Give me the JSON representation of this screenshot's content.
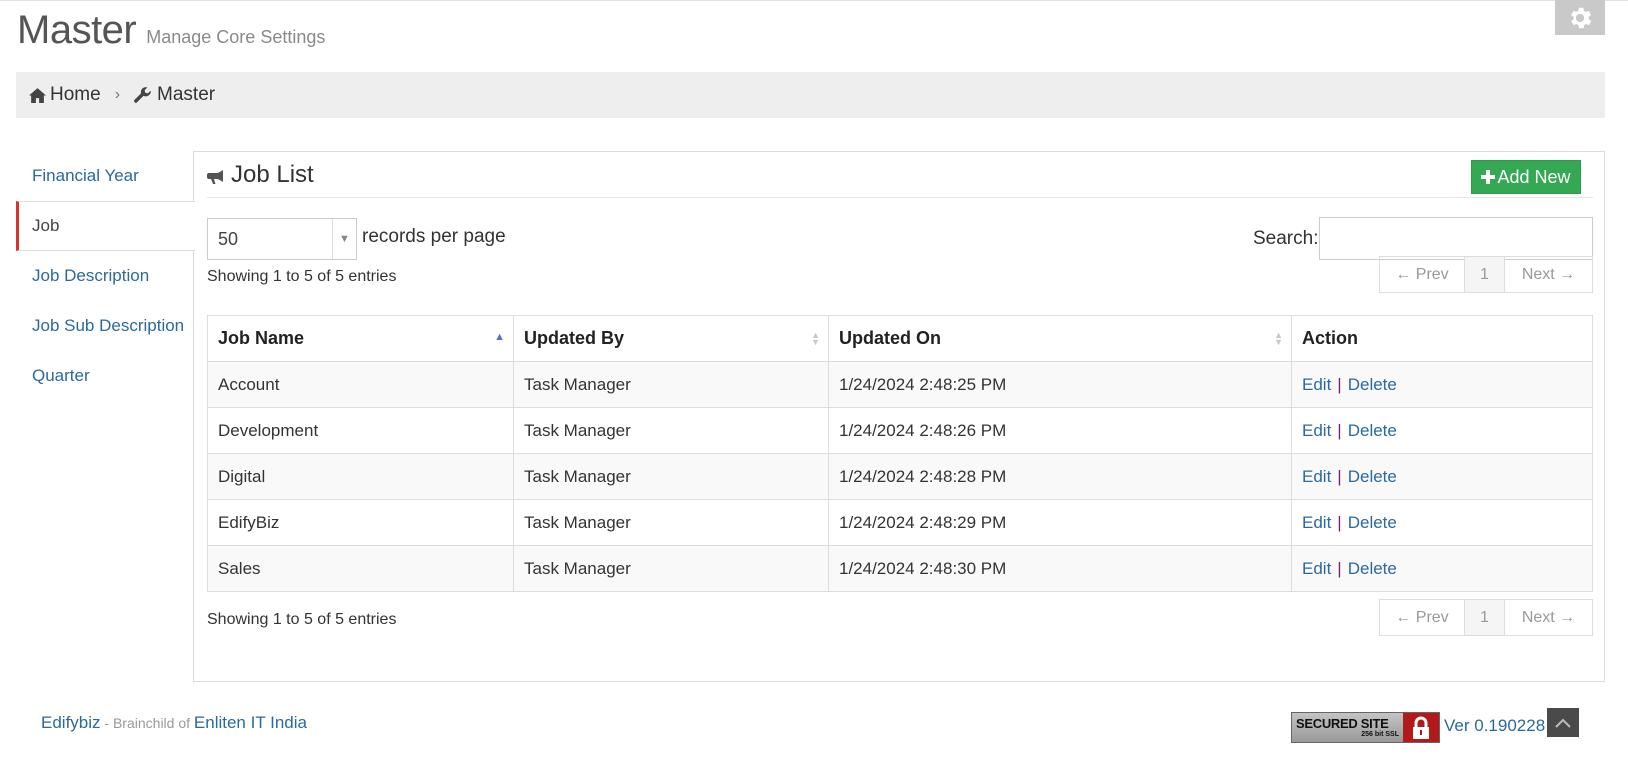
{
  "header": {
    "title": "Master",
    "subtitle": "Manage Core Settings"
  },
  "breadcrumb": {
    "home": "Home",
    "current": "Master"
  },
  "sidebar": {
    "items": [
      {
        "label": "Financial Year"
      },
      {
        "label": "Job"
      },
      {
        "label": "Job Description"
      },
      {
        "label": "Job Sub Description"
      },
      {
        "label": "Quarter"
      }
    ],
    "active_index": 1
  },
  "panel": {
    "title": "Job List",
    "add_button": "Add New"
  },
  "controls": {
    "page_length": "50",
    "page_length_label": "records per page",
    "search_label": "Search:",
    "search_value": "",
    "info_text": "Showing 1 to 5 of 5 entries"
  },
  "pagination": {
    "prev": "← Prev",
    "current": "1",
    "next": "Next →"
  },
  "table": {
    "columns": [
      "Job Name",
      "Updated By",
      "Updated On",
      "Action"
    ],
    "sorted_column": "Job Name",
    "sort_direction": "asc",
    "rows": [
      {
        "job_name": "Account",
        "updated_by": "Task Manager",
        "updated_on": "1/24/2024 2:48:25 PM"
      },
      {
        "job_name": "Development",
        "updated_by": "Task Manager",
        "updated_on": "1/24/2024 2:48:26 PM"
      },
      {
        "job_name": "Digital",
        "updated_by": "Task Manager",
        "updated_on": "1/24/2024 2:48:28 PM"
      },
      {
        "job_name": "EdifyBiz",
        "updated_by": "Task Manager",
        "updated_on": "1/24/2024 2:48:29 PM"
      },
      {
        "job_name": "Sales",
        "updated_by": "Task Manager",
        "updated_on": "1/24/2024 2:48:30 PM"
      }
    ],
    "edit_label": "Edit",
    "separator": "|",
    "delete_label": "Delete"
  },
  "footer": {
    "brand": "Edifybiz",
    "tagline": " - Brainchild of ",
    "company": "Enliten IT India",
    "ssl_title": "SECURED SITE",
    "ssl_sub": "256 bit SSL",
    "version": "Ver 0.190228"
  },
  "icons": {
    "settings": "gear-icon",
    "home": "home-icon",
    "master": "wrench-icon",
    "panel": "bullhorn-icon",
    "add": "plus-icon",
    "ssl": "lock-icon",
    "top": "chevron-up-icon"
  },
  "colors": {
    "link": "#2a6a9c",
    "add_button": "#35a853",
    "active_nav_border": "#d9322f",
    "breadcrumb_bg": "#eeeeee",
    "ssl_lock": "#b3191b"
  }
}
